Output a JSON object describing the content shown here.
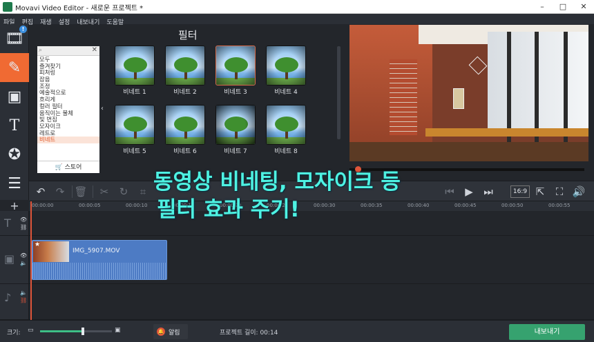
{
  "window": {
    "title": "Movavi Video Editor - 새로운 프로젝트 *",
    "controls": [
      "–",
      "□",
      "✕"
    ]
  },
  "menu": [
    "파일",
    "편집",
    "재생",
    "설정",
    "내보내기",
    "도움말"
  ],
  "rail": {
    "badge": "!",
    "icons": [
      "film-import-icon",
      "magic-wand-icon",
      "transition-icon",
      "text-icon",
      "sticker-star-icon",
      "menu-lines-icon"
    ]
  },
  "filters": {
    "title": "필터",
    "categories": [
      "모두",
      "즐겨찾기",
      "피처링",
      "잡음",
      "조정",
      "예술적으로",
      "흐리게",
      "컬러 필터",
      "움직이는 물체",
      "빛 번짐",
      "모자이크",
      "레트로",
      "비네트"
    ],
    "selected_category": "비네트",
    "store_label": "스토어",
    "items": [
      "비네트 1",
      "비네트 2",
      "비네트 3",
      "비네트 4",
      "비네트 5",
      "비네트 6",
      "비네트 7",
      "비네트 8"
    ]
  },
  "player": {
    "aspect_ratio": "16:9",
    "progress": 0.035
  },
  "timeline": {
    "ticks": [
      "00:00:00",
      "00:00:05",
      "00:00:10",
      "00:00:15",
      "00:00:20",
      "00:00:25",
      "00:00:30",
      "00:00:35",
      "00:00:40",
      "00:00:45",
      "00:00:50",
      "00:00:55"
    ],
    "clip_name": "IMG_5907.MOV"
  },
  "status": {
    "zoom_label": "크기:",
    "zoom_level": 0.6,
    "notify_label": "알림",
    "project_length_label": "프로젝트 길이:",
    "project_length": "00:14",
    "export_label": "내보내기"
  },
  "caption": {
    "line1": "동영상 비네팅, 모자이크 등",
    "line2": "필터 효과 주기!",
    "color": "#4ef2e2"
  },
  "colors": {
    "accent": "#f06a33",
    "export": "#36a26f",
    "clip": "#4d7bc4"
  }
}
